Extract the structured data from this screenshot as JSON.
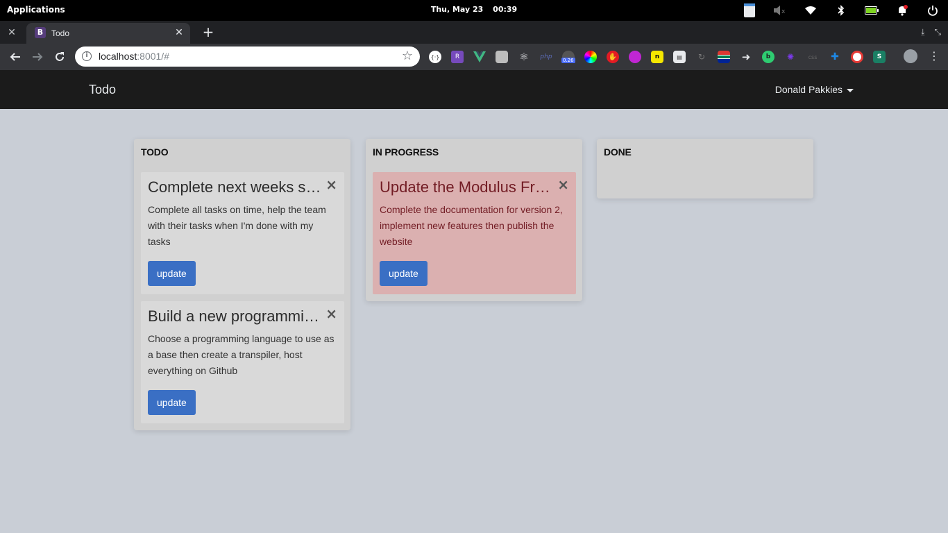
{
  "system_bar": {
    "applications_label": "Applications",
    "date": "Thu, May 23",
    "time": "00:39"
  },
  "browser": {
    "tab": {
      "favicon_letter": "B",
      "title": "Todo"
    },
    "address": {
      "host": "localhost",
      "rest": ":8001/#"
    },
    "extension_badge": "0.26"
  },
  "app": {
    "brand": "Todo",
    "user_name": "Donald Pakkies"
  },
  "columns": [
    {
      "title": "TODO",
      "cards": [
        {
          "title": "Complete next weeks sprint",
          "text": "Complete all tasks on time, help the team with their tasks when I'm done with my tasks",
          "button": "update",
          "close": "×"
        },
        {
          "title": "Build a new programming language",
          "text": "Choose a programming language to use as a base then create a transpiler, host everything on Github",
          "button": "update",
          "close": "×"
        }
      ]
    },
    {
      "title": "IN PROGRESS",
      "cards": [
        {
          "title": "Update the Modulus Framework",
          "text": "Complete the documentation for version 2, implement new features then publish the website",
          "button": "update",
          "close": "×"
        }
      ]
    },
    {
      "title": "DONE",
      "cards": []
    }
  ]
}
